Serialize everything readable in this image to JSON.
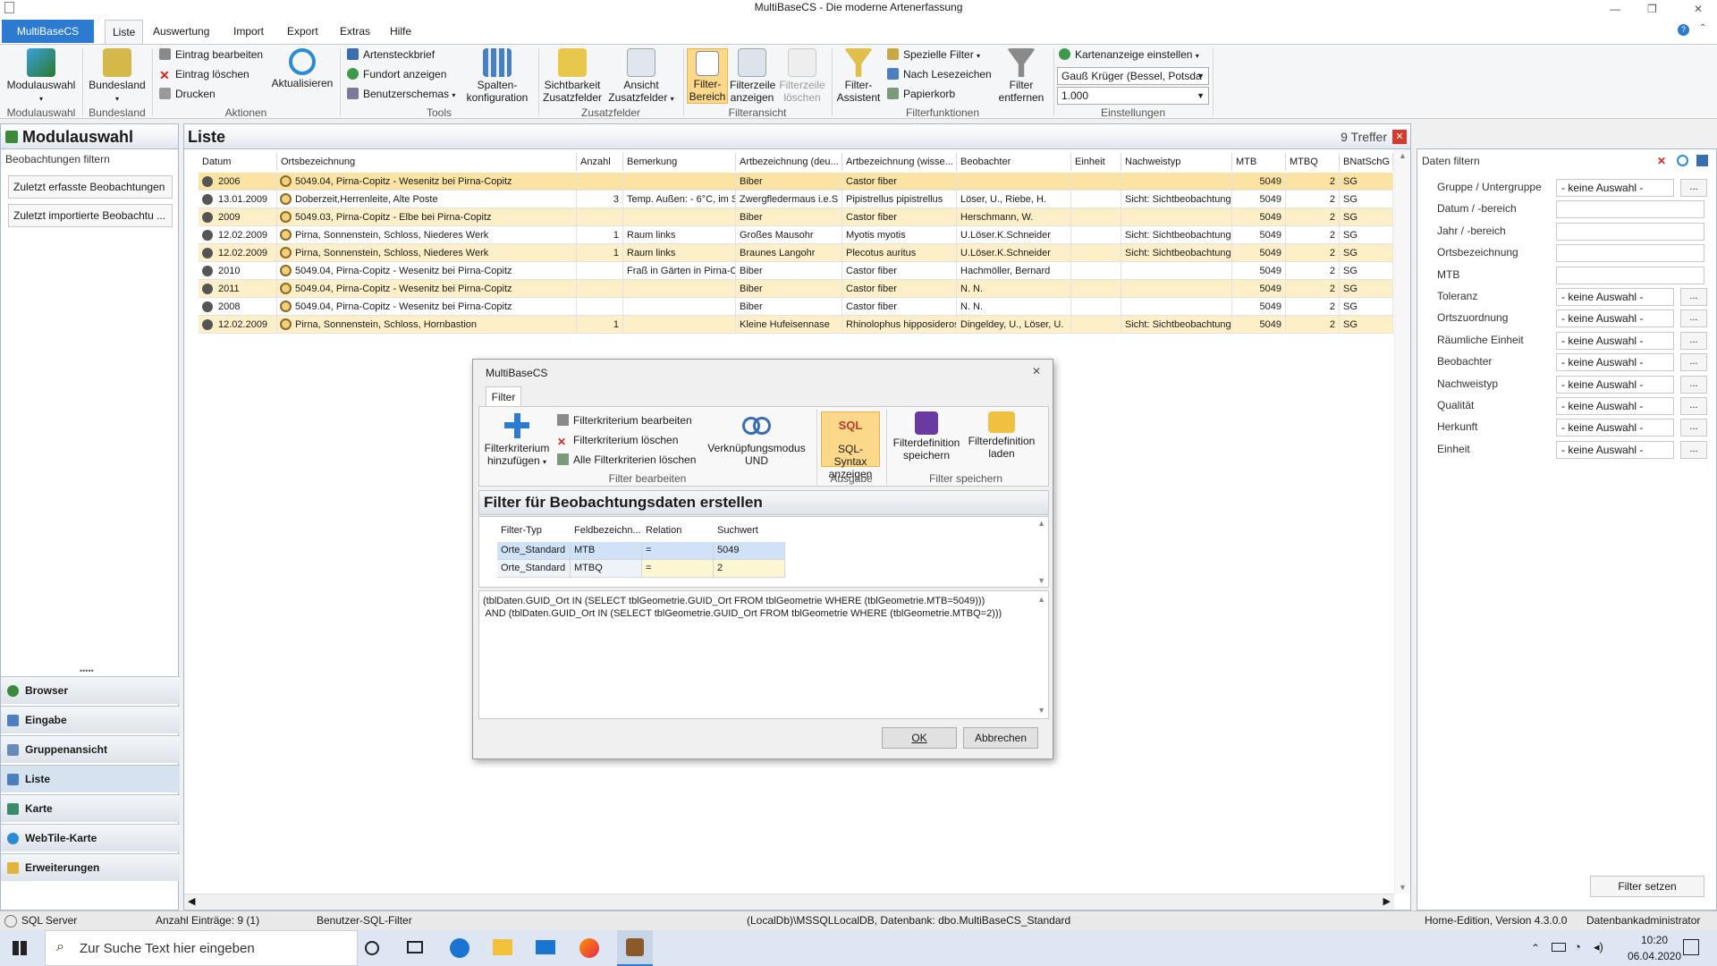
{
  "window": {
    "title": "MultiBaseCS - Die moderne Artenerfassung",
    "minimize": "—",
    "restore": "❐",
    "close": "✕"
  },
  "menu": {
    "file": "MultiBaseCS",
    "tabs": [
      "Liste",
      "Auswertung",
      "Import",
      "Export",
      "Extras",
      "Hilfe"
    ]
  },
  "ribbon": {
    "modulauswahl": "Modulauswahl",
    "bundesland": "Bundesland",
    "eintrag_bearbeiten": "Eintrag bearbeiten",
    "eintrag_loeschen": "Eintrag löschen",
    "drucken": "Drucken",
    "aktualisieren": "Aktualisieren",
    "artensteckbrief": "Artensteckbrief",
    "fundort_anzeigen": "Fundort anzeigen",
    "benutzerschemas": "Benutzerschemas",
    "spalten1": "Spalten-",
    "spalten2": "konfiguration",
    "sicht1": "Sichtbarkeit",
    "sicht2": "Zusatzfelder",
    "ansicht1": "Ansicht",
    "ansicht2": "Zusatzfelder",
    "filterb1": "Filter-",
    "filterb2": "Bereich",
    "filterz1": "Filterzeile",
    "filterz2": "anzeigen",
    "filterl1": "Filterzeile",
    "filterl2": "löschen",
    "fassist1": "Filter-",
    "fassist2": "Assistent",
    "spezielle_filter": "Spezielle Filter",
    "nach_lesezeichen": "Nach Lesezeichen",
    "papierkorb": "Papierkorb",
    "fentf1": "Filter",
    "fentf2": "entfernen",
    "kartenanzeige": "Kartenanzeige einstellen",
    "gauss": "Gauß Krüger (Bessel, Potsda",
    "scale": "1.000",
    "groups": [
      "Modulauswahl",
      "Bundesland",
      "Aktionen",
      "Tools",
      "Zusatzfelder",
      "Filteransicht",
      "Filterfunktionen",
      "Einstellungen"
    ]
  },
  "left": {
    "title": "Modulauswahl",
    "section": "Beobachtungen filtern",
    "btn1": "Zuletzt erfasste Beobachtungen",
    "btn2": "Zuletzt  importierte Beobachtu ...",
    "nav": [
      "Browser",
      "Eingabe",
      "Gruppenansicht",
      "Liste",
      "Karte",
      "WebTile-Karte",
      "Erweiterungen"
    ]
  },
  "list": {
    "title": "Liste",
    "hits": "9 Treffer",
    "columns": [
      "Datum",
      "Ortsbezeichnung",
      "Anzahl",
      "Bemerkung",
      "Artbezeichnung (deu...",
      "Artbezeichnung (wisse...",
      "Beobachter",
      "Einheit",
      "Nachweistyp",
      "MTB",
      "MTBQ",
      "BNatSchG"
    ],
    "rows": [
      {
        "datum": "2006",
        "ort": "5049.04, Pirna-Copitz - Wesenitz bei Pirna-Copitz",
        "anzahl": "",
        "bem": "",
        "art_de": "Biber",
        "art_wiss": "Castor fiber",
        "beob": "",
        "einheit": "",
        "nachweis": "",
        "mtb": "5049",
        "mtbq": "2",
        "bnat": "SG"
      },
      {
        "datum": "13.01.2009",
        "ort": "Doberzeit,Herrenleite, Alte Poste",
        "anzahl": "3",
        "bem": "Temp. Außen: - 6°C, im St",
        "art_de": "Zwergfledermaus i.e.S",
        "art_wiss": "Pipistrellus pipistrellus",
        "beob": "Löser, U., Riebe, H.",
        "einheit": "",
        "nachweis": "Sicht: Sichtbeobachtung",
        "mtb": "5049",
        "mtbq": "2",
        "bnat": "SG"
      },
      {
        "datum": "2009",
        "ort": "5049.03, Pirna-Copitz - Elbe bei Pirna-Copitz",
        "anzahl": "",
        "bem": "",
        "art_de": "Biber",
        "art_wiss": "Castor fiber",
        "beob": "Herschmann, W.",
        "einheit": "",
        "nachweis": "",
        "mtb": "5049",
        "mtbq": "2",
        "bnat": "SG"
      },
      {
        "datum": "12.02.2009",
        "ort": "Pirna, Sonnenstein, Schloss, Niederes Werk",
        "anzahl": "1",
        "bem": "Raum  links",
        "art_de": "Großes Mausohr",
        "art_wiss": "Myotis myotis",
        "beob": "U.Löser.K.Schneider",
        "einheit": "",
        "nachweis": "Sicht: Sichtbeobachtung",
        "mtb": "5049",
        "mtbq": "2",
        "bnat": "SG"
      },
      {
        "datum": "12.02.2009",
        "ort": "Pirna, Sonnenstein, Schloss, Niederes Werk",
        "anzahl": "1",
        "bem": "Raum  links",
        "art_de": "Braunes Langohr",
        "art_wiss": "Plecotus auritus",
        "beob": "U.Löser.K.Schneider",
        "einheit": "",
        "nachweis": "Sicht: Sichtbeobachtung",
        "mtb": "5049",
        "mtbq": "2",
        "bnat": "SG"
      },
      {
        "datum": "2010",
        "ort": "5049.04, Pirna-Copitz - Wesenitz bei Pirna-Copitz",
        "anzahl": "",
        "bem": "Fraß in Gärten in Pirna-Co",
        "art_de": "Biber",
        "art_wiss": "Castor fiber",
        "beob": "Hachmöller, Bernard",
        "einheit": "",
        "nachweis": "",
        "mtb": "5049",
        "mtbq": "2",
        "bnat": "SG"
      },
      {
        "datum": "2011",
        "ort": "5049.04, Pirna-Copitz - Wesenitz bei Pirna-Copitz",
        "anzahl": "",
        "bem": "",
        "art_de": "Biber",
        "art_wiss": "Castor fiber",
        "beob": "N. N.",
        "einheit": "",
        "nachweis": "",
        "mtb": "5049",
        "mtbq": "2",
        "bnat": "SG"
      },
      {
        "datum": "2008",
        "ort": "5049.04, Pirna-Copitz - Wesenitz bei Pirna-Copitz",
        "anzahl": "",
        "bem": "",
        "art_de": "Biber",
        "art_wiss": "Castor fiber",
        "beob": "N. N.",
        "einheit": "",
        "nachweis": "",
        "mtb": "5049",
        "mtbq": "2",
        "bnat": "SG"
      },
      {
        "datum": "12.02.2009",
        "ort": "Pirna, Sonnenstein, Schloss, Hornbastion",
        "anzahl": "1",
        "bem": "",
        "art_de": "Kleine Hufeisennase",
        "art_wiss": "Rhinolophus hipposideros",
        "beob": "Dingeldey, U., Löser, U.",
        "einheit": "",
        "nachweis": "Sicht: Sichtbeobachtung",
        "mtb": "5049",
        "mtbq": "2",
        "bnat": "SG"
      }
    ]
  },
  "right": {
    "title": "Daten filtern",
    "fields": [
      {
        "label": "Gruppe / Untergruppe",
        "value": "- keine Auswahl -",
        "btn": "..."
      },
      {
        "label": "Datum / -bereich",
        "value": "",
        "btn": ""
      },
      {
        "label": "Jahr / -bereich",
        "value": "",
        "btn": ""
      },
      {
        "label": "Ortsbezeichnung",
        "value": "",
        "btn": ""
      },
      {
        "label": "MTB",
        "value": "",
        "btn": ""
      },
      {
        "label": "Toleranz",
        "value": "- keine Auswahl -",
        "btn": "..."
      },
      {
        "label": "Ortszuordnung",
        "value": "- keine Auswahl -",
        "btn": "..."
      },
      {
        "label": "Räumliche Einheit",
        "value": "- keine Auswahl -",
        "btn": "..."
      },
      {
        "label": "Beobachter",
        "value": "- keine Auswahl -",
        "btn": "..."
      },
      {
        "label": "Nachweistyp",
        "value": "- keine Auswahl -",
        "btn": "..."
      },
      {
        "label": "Qualität",
        "value": "- keine Auswahl -",
        "btn": "..."
      },
      {
        "label": "Herkunft",
        "value": "- keine Auswahl -",
        "btn": "..."
      },
      {
        "label": "Einheit",
        "value": "- keine Auswahl -",
        "btn": "..."
      }
    ],
    "filter_setzen": "Filter setzen"
  },
  "dialog": {
    "title": "MultiBaseCS",
    "tab": "Filter",
    "add1": "Filterkriterium",
    "add2": "hinzufügen",
    "edit": "Filterkriterium bearbeiten",
    "delete": "Filterkriterium löschen",
    "delete_all": "Alle Filterkriterien löschen",
    "mode1": "Verknüpfungsmodus",
    "mode2": "UND",
    "sql1": "SQL-Syntax",
    "sql2": "anzeigen",
    "save1": "Filterdefinition",
    "save2": "speichern",
    "load1": "Filterdefinition",
    "load2": "laden",
    "groups": [
      "Filter bearbeiten",
      "Ausgabe",
      "Filter speichern"
    ],
    "heading": "Filter für Beobachtungsdaten erstellen",
    "table_headers": [
      "Filter-Typ",
      "Feldbezeichn...",
      "Relation",
      "Suchwert"
    ],
    "table_rows": [
      [
        "Orte_Standard",
        "MTB",
        "=",
        "5049"
      ],
      [
        "Orte_Standard",
        "MTBQ",
        "=",
        "2"
      ]
    ],
    "sql_line1": "(tblDaten.GUID_Ort IN (SELECT tblGeometrie.GUID_Ort FROM tblGeometrie WHERE (tblGeometrie.MTB=5049)))",
    "sql_line2": " AND (tblDaten.GUID_Ort IN (SELECT tblGeometrie.GUID_Ort FROM tblGeometrie WHERE (tblGeometrie.MTBQ=2)))",
    "ok": "OK",
    "cancel": "Abbrechen"
  },
  "status": {
    "server": "SQL Server",
    "entries": "Anzahl Einträge: 9 (1)",
    "filter": "Benutzer-SQL-Filter",
    "db": "(LocalDb)\\MSSQLLocalDB, Datenbank: dbo.MultiBaseCS_Standard",
    "edition": "Home-Edition, Version 4.3.0.0",
    "admin": "Datenbankadministrator"
  },
  "taskbar": {
    "search_placeholder": "Zur Suche Text hier eingeben",
    "time": "10:20",
    "date": "06.04.2020"
  },
  "colors": {
    "accent": "#2c7bd1",
    "row_highlight": "#fdf0c8",
    "row_selected": "#fbe3a4"
  }
}
